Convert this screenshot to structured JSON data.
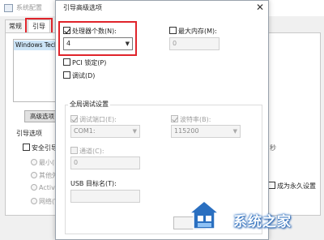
{
  "background_window": {
    "title": "系统配置",
    "tabs": [
      {
        "label": "常规",
        "selected": false
      },
      {
        "label": "引导",
        "selected": true
      }
    ],
    "os_entry": "Windows Technical Preview",
    "advanced_button": "高级选项",
    "boot_options_label": "引导选项",
    "safe_boot_label": "安全引导(",
    "radio_options": [
      "最小(N",
      "其他外",
      "Active",
      "网络(V"
    ],
    "right_fragments": {
      "frag1": "秒",
      "frag2": "成为永久设置"
    }
  },
  "dialog": {
    "title": "引导高级选项",
    "close_glyph": "✕",
    "processor_count": {
      "label": "处理器个数(N):",
      "checked": true,
      "value": "4"
    },
    "max_memory": {
      "label": "最大内存(M):",
      "checked": false,
      "value": "0"
    },
    "pci_lock": {
      "label": "PCI 锁定(P)",
      "checked": false
    },
    "debug": {
      "label": "调试(D)",
      "checked": false
    },
    "global_debug_group": "全局调试设置",
    "debug_port": {
      "label": "调试端口(E):",
      "checked": true,
      "value": "COM1:"
    },
    "baud_rate": {
      "label": "波特率(B):",
      "checked": true,
      "value": "115200"
    },
    "channel": {
      "label": "通道(C):",
      "checked": false,
      "value": "0"
    },
    "usb_target": {
      "label": "USB 目标名(T):",
      "value": ""
    }
  },
  "watermark": {
    "text": "系统之家"
  },
  "colors": {
    "highlight": "#e0242b",
    "selection": "#cce4f7",
    "watermark_blue": "#2a6fc0"
  }
}
